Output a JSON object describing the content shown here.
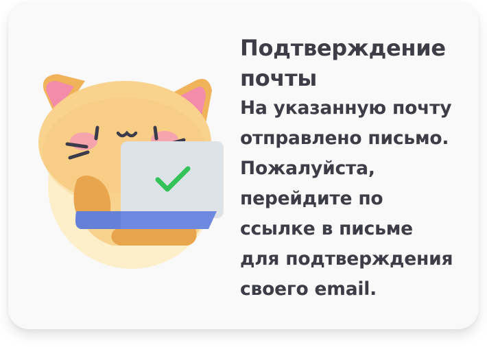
{
  "dialog": {
    "title_line1": "Подтверждение",
    "title_line2": "почты",
    "message_lines": [
      "На указанную почту",
      "отправлено письмо.",
      "Пожалуйста,",
      "перейдите по",
      "ссылке в письме",
      "для подтверждения",
      "своего email."
    ],
    "illustration": "cat-with-laptop-checkmark",
    "colors": {
      "card_background": "#f9f9f9",
      "text": "#3d3d47",
      "cat_fur": "#f9d28e",
      "cat_ears_inner": "#f38bab",
      "laptop_screen": "#dde2e6",
      "laptop_base": "#6e8ae0",
      "checkmark": "#35c15a"
    }
  }
}
